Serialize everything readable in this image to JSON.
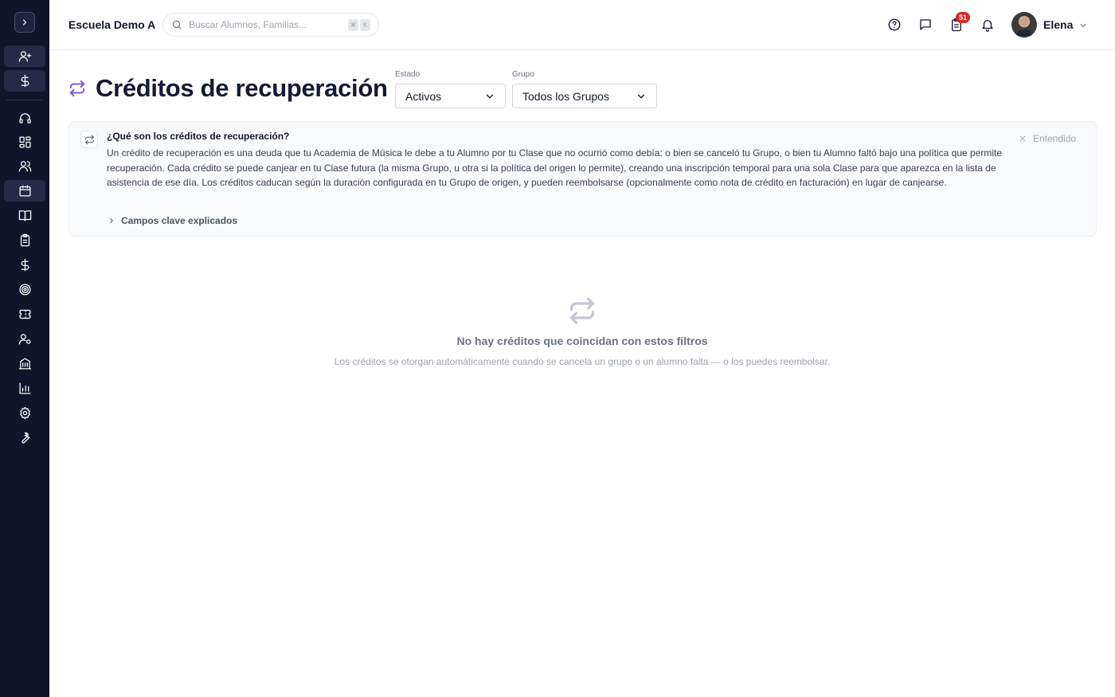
{
  "sidebar": {
    "toggle_icon": "chevron-right-icon",
    "items": [
      {
        "name": "add-user-icon"
      },
      {
        "name": "dollar-icon"
      },
      {
        "name": "headset-icon"
      },
      {
        "name": "dashboard-icon"
      },
      {
        "name": "users-icon"
      },
      {
        "name": "calendar-icon"
      },
      {
        "name": "book-icon"
      },
      {
        "name": "clipboard-icon"
      },
      {
        "name": "dollar-icon"
      },
      {
        "name": "target-icon"
      },
      {
        "name": "ticket-icon"
      },
      {
        "name": "user-settings-icon"
      },
      {
        "name": "building-icon"
      },
      {
        "name": "bar-chart-icon"
      },
      {
        "name": "gear-icon"
      },
      {
        "name": "wrench-icon"
      }
    ],
    "active_index": 5
  },
  "header": {
    "school_name": "Escuela Demo A",
    "search": {
      "placeholder": "Buscar Alumnos, Familias...",
      "shortcut_keys": [
        "⌘",
        "K"
      ]
    },
    "icons": [
      "help-icon",
      "chat-icon",
      "tasks-icon",
      "bell-icon"
    ],
    "tasks_badge": "51",
    "user": {
      "name": "Elena"
    }
  },
  "page": {
    "title": "Créditos de recuperación",
    "filters": {
      "estado": {
        "label": "Estado",
        "value": "Activos"
      },
      "grupo": {
        "label": "Grupo",
        "value": "Todos los Grupos"
      }
    }
  },
  "info_panel": {
    "title": "¿Qué son los créditos de recuperación?",
    "body": "Un crédito de recuperación es una deuda que tu Academia de Música le debe a tu Alumno por tu Clase que no ocurrió como debía: o bien se canceló tu Grupo, o bien tu Alumno faltó bajo una política que permite recuperación. Cada crédito se puede canjear en tu Clase futura (la misma Grupo, u otra si la política del origen lo permite), creando una inscripción temporal para una sola Clase para que aparezca en la lista de asistencia de ese día. Los créditos caducan según la duración configurada en tu Grupo de origen, y pueden reembolsarse (opcionalmente como nota de crédito en facturación) en lugar de canjearse.",
    "dismiss_label": "Entendido",
    "expand_label": "Campos clave explicados"
  },
  "empty_state": {
    "title": "No hay créditos que coincidan con estos filtros",
    "subtitle": "Los créditos se otorgan automáticamente cuando se cancela un grupo o un alumno falta — o los puedes reembolsar."
  },
  "colors": {
    "sidebar_bg": "#12142b",
    "accent": "#7c5cd6",
    "badge": "#dc2626"
  }
}
